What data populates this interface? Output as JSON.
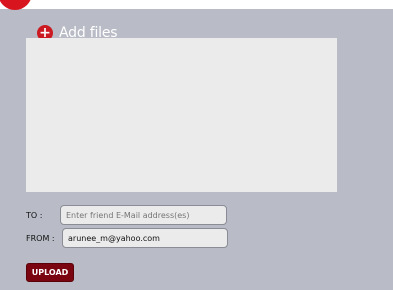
{
  "add_files": {
    "label": "Add files",
    "icon": "plus-circle-icon"
  },
  "to_row": {
    "label": "TO   :",
    "placeholder": "Enter friend E-Mail address(es)"
  },
  "from_row": {
    "label": "FROM :",
    "value": "arunee_m@yahoo.com"
  },
  "upload_button": {
    "label": "UPLOAD"
  },
  "colors": {
    "accent": "#d8141e",
    "button": "#7a0410",
    "background": "#b9bcc6"
  }
}
